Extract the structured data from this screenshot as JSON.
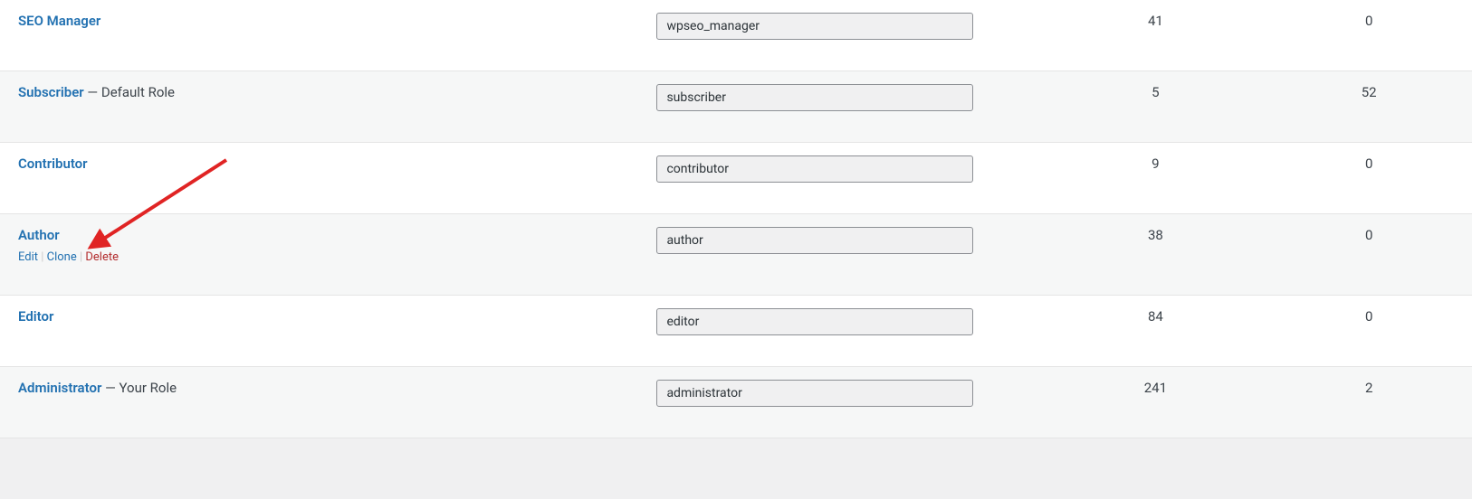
{
  "roles": [
    {
      "name": "SEO Manager",
      "slug": "wpseo_manager",
      "num1": "41",
      "num2": "0",
      "suffix": "",
      "showActions": false
    },
    {
      "name": "Subscriber",
      "slug": "subscriber",
      "num1": "5",
      "num2": "52",
      "suffix": " — Default Role",
      "showActions": false
    },
    {
      "name": "Contributor",
      "slug": "contributor",
      "num1": "9",
      "num2": "0",
      "suffix": "",
      "showActions": false
    },
    {
      "name": "Author",
      "slug": "author",
      "num1": "38",
      "num2": "0",
      "suffix": "",
      "showActions": true
    },
    {
      "name": "Editor",
      "slug": "editor",
      "num1": "84",
      "num2": "0",
      "suffix": "",
      "showActions": false
    },
    {
      "name": "Administrator",
      "slug": "administrator",
      "num1": "241",
      "num2": "2",
      "suffix": " — Your Role",
      "showActions": false
    }
  ],
  "actions": {
    "edit": "Edit",
    "clone": "Clone",
    "delete": "Delete",
    "sep": " | "
  }
}
